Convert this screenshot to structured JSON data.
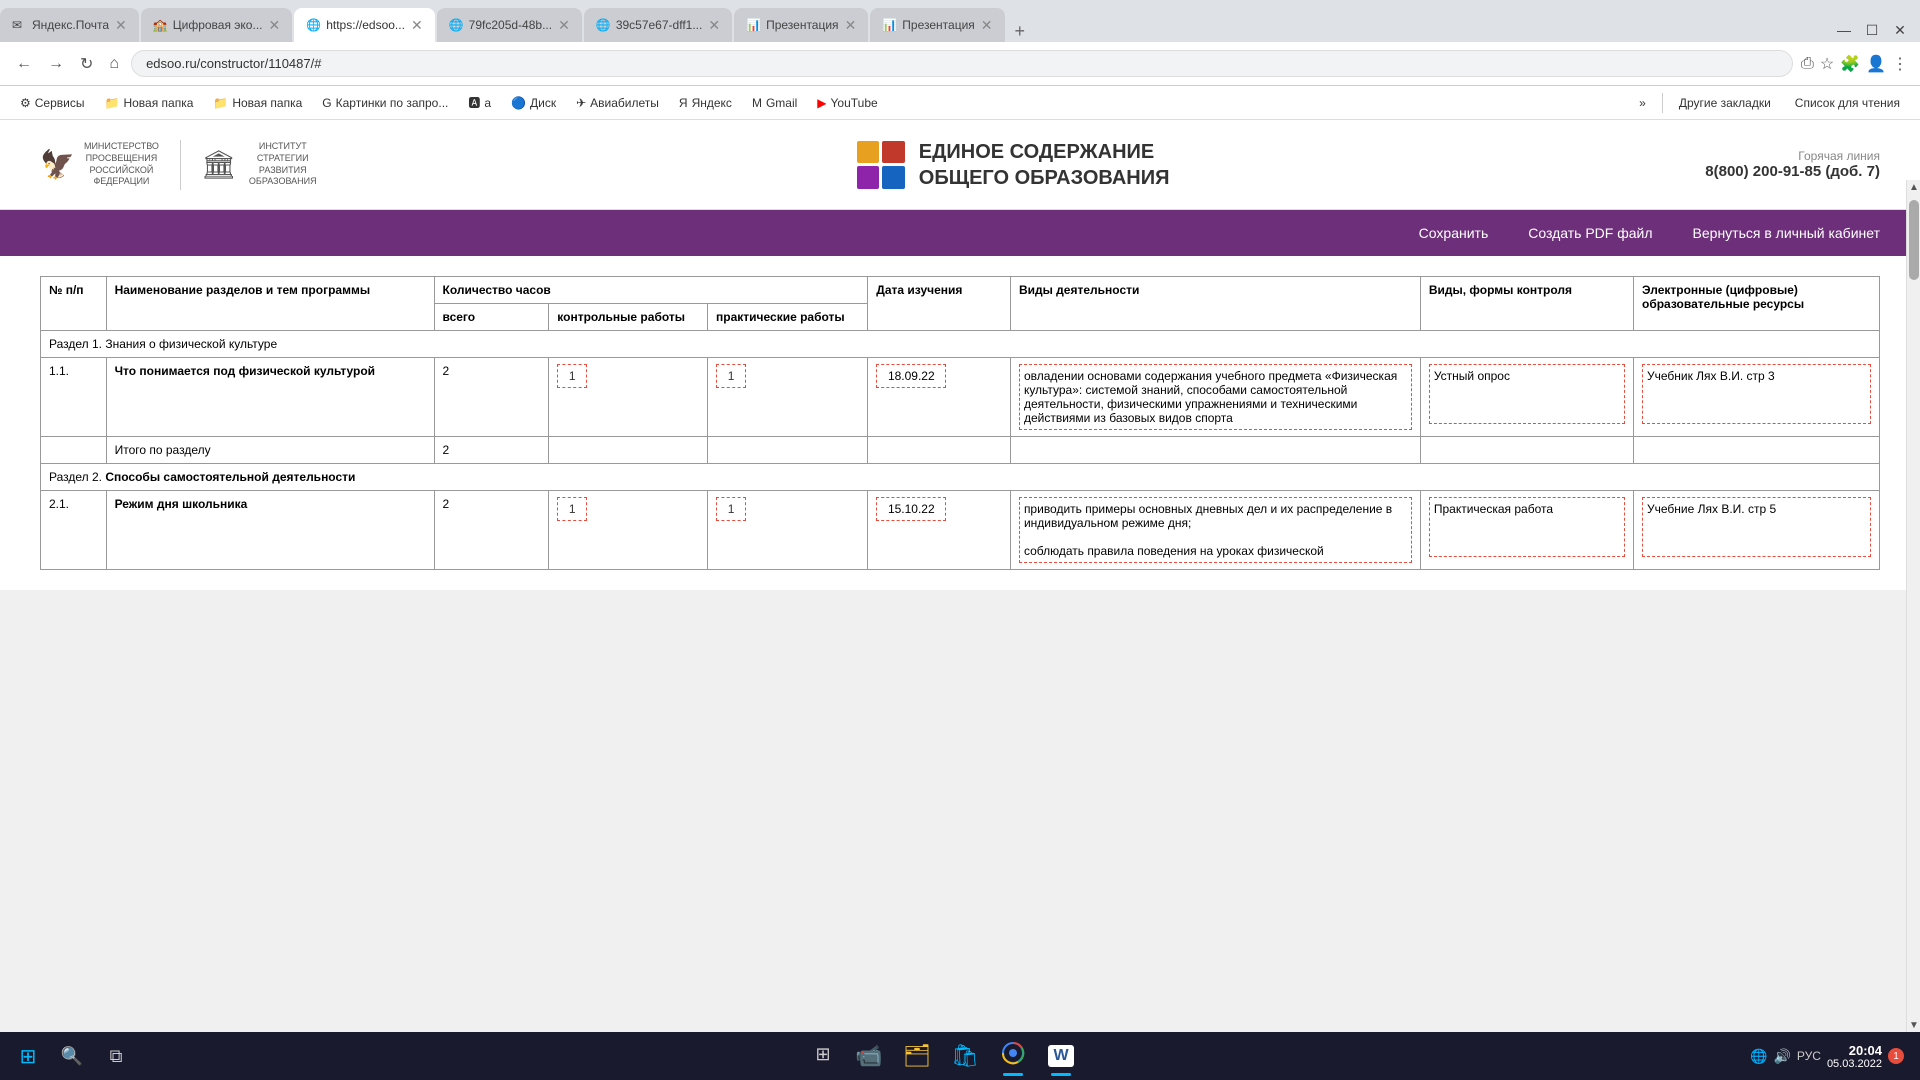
{
  "browser": {
    "tabs": [
      {
        "id": 1,
        "title": "Яндекс.Почта",
        "favicon": "✉",
        "active": false
      },
      {
        "id": 2,
        "title": "Цифровая эко...",
        "favicon": "🏫",
        "active": false
      },
      {
        "id": 3,
        "title": "https://edsoo...",
        "favicon": "🌐",
        "active": true
      },
      {
        "id": 4,
        "title": "79fc205d-48b...",
        "favicon": "🌐",
        "active": false
      },
      {
        "id": 5,
        "title": "39c57e67-dff1...",
        "favicon": "🌐",
        "active": false
      },
      {
        "id": 6,
        "title": "Презентация",
        "favicon": "📊",
        "active": false
      },
      {
        "id": 7,
        "title": "Презентация",
        "favicon": "📊",
        "active": false
      }
    ],
    "url": "edsoo.ru/constructor/110487/#",
    "bookmarks": [
      {
        "label": "Сервисы",
        "icon": "⚙"
      },
      {
        "label": "Новая папка",
        "icon": "📁"
      },
      {
        "label": "Новая папка",
        "icon": "📁"
      },
      {
        "label": "Картинки по запро...",
        "icon": "G"
      },
      {
        "label": "a",
        "icon": "🅰"
      },
      {
        "label": "Диск",
        "icon": "🔵"
      },
      {
        "label": "Авиабилеты",
        "icon": "✈"
      },
      {
        "label": "Яндекс",
        "icon": "Я"
      },
      {
        "label": "Gmail",
        "icon": "M"
      },
      {
        "label": "YouTube",
        "icon": "▶"
      }
    ],
    "more_bookmarks": "»",
    "other_bookmarks": "Другие закладки",
    "reading_list": "Список для чтения"
  },
  "site": {
    "header": {
      "logo1_text": "МИНИСТЕРСТВО ПРОСВЕЩЕНИЯ РОССИЙСКОЙ ФЕДЕРАЦИИ",
      "logo2_text": "ИНСТИТУТ СТРАТЕГИИ РАЗВИТИЯ ОБРАЗОВАНИЯ",
      "main_title_line1": "ЕДИНОЕ СОДЕРЖАНИЕ",
      "main_title_line2": "ОБЩЕГО ОБРАЗОВАНИЯ",
      "hotline_label": "Горячая линия",
      "hotline_number": "8(800) 200-91-85",
      "hotline_ext": "(доб. 7)"
    },
    "nav": {
      "save": "Сохранить",
      "create_pdf": "Создать PDF файл",
      "back_to_cabinet": "Вернуться в личный кабинет"
    },
    "table": {
      "headers": {
        "num": "№ п/п",
        "name": "Наименование разделов и тем программы",
        "hours_group": "Количество часов",
        "hours_total": "всего",
        "hours_control": "контрольные работы",
        "hours_practical": "практические работы",
        "date": "Дата изучения",
        "activity": "Виды деятельности",
        "control": "Виды, формы контроля",
        "resource": "Электронные (цифровые) образовательные ресурсы"
      },
      "sections": [
        {
          "type": "section-header",
          "title": "Раздел 1. Знания о физической культуре"
        },
        {
          "type": "data-row",
          "num": "1.1.",
          "name": "Что понимается под физической культурой",
          "hours_total": "2",
          "hours_control": "1",
          "hours_practical": "1",
          "date": "18.09.22",
          "activity": "овладении основами содержания учебного предмета «Физическая культура»: системой знаний, способами самостоятельной деятельности, физическими упражнениями и техническими действиями из базовых видов спорта",
          "control": "Устный опрос",
          "resource": "Учебник Лях В.И. стр 3"
        },
        {
          "type": "total-row",
          "label": "Итого по разделу",
          "total": "2"
        },
        {
          "type": "section-header",
          "title": "Раздел 2. ",
          "title_bold": "Способы самостоятельной деятельности"
        },
        {
          "type": "data-row",
          "num": "2.1.",
          "name": "Режим дня школьника",
          "hours_total": "2",
          "hours_control": "1",
          "hours_practical": "1",
          "date": "15.10.22",
          "activity": "приводить примеры основных дневных дел и их распределение в индивидуальном режиме дня;\n\nсоблюдать правила поведения на уроках физической",
          "control": "Практическая работа",
          "resource": "Учебние Лях В.И. стр 5"
        }
      ]
    }
  },
  "taskbar": {
    "time": "20:04",
    "date": "05.03.2022",
    "notification_count": "1",
    "kb_indicator": "РУС",
    "apps": [
      {
        "name": "start",
        "icon": "⊞",
        "active": false
      },
      {
        "name": "search",
        "icon": "🔍",
        "active": false
      },
      {
        "name": "task-view",
        "icon": "🗖",
        "active": false
      },
      {
        "name": "widgets",
        "icon": "⊞",
        "active": false
      },
      {
        "name": "teams",
        "icon": "📹",
        "active": false
      },
      {
        "name": "files",
        "icon": "🗂",
        "active": false
      },
      {
        "name": "store",
        "icon": "🛍",
        "active": false
      },
      {
        "name": "chrome",
        "icon": "◎",
        "active": true
      },
      {
        "name": "word",
        "icon": "W",
        "active": true
      }
    ]
  }
}
